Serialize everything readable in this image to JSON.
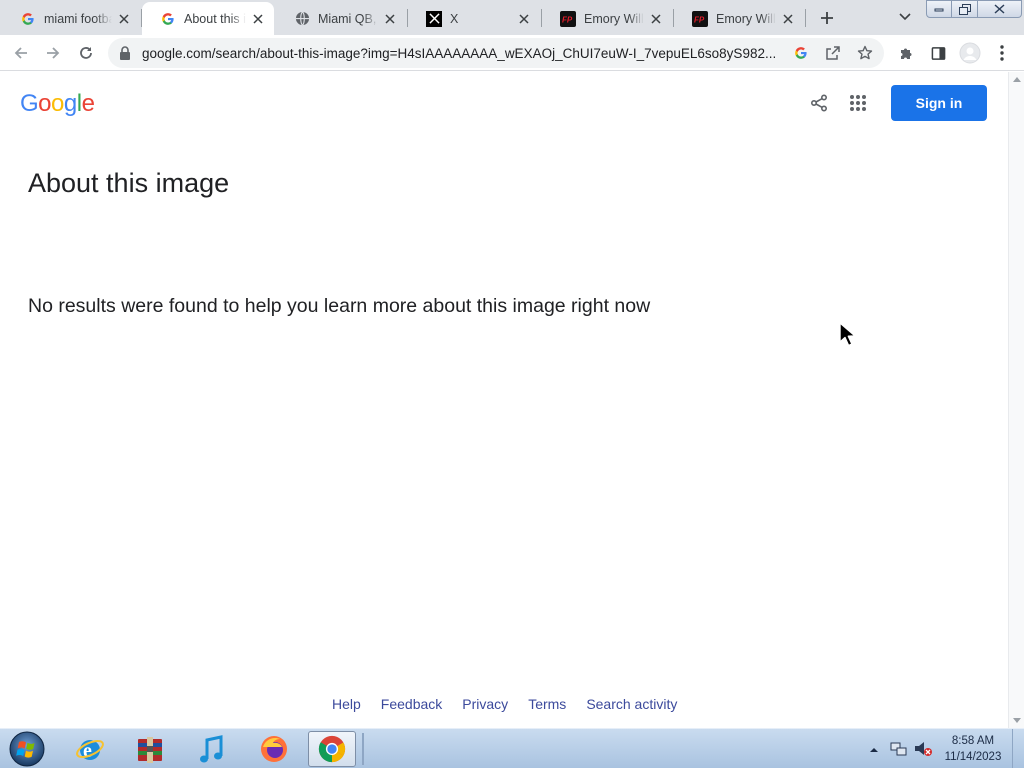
{
  "browser": {
    "tabs": [
      {
        "title": "miami football",
        "favicon": "google-g-icon",
        "active": false
      },
      {
        "title": "About this image",
        "favicon": "google-g-icon",
        "active": true
      },
      {
        "title": "Miami QB, Miami",
        "favicon": "globe-icon",
        "active": false
      },
      {
        "title": "X",
        "favicon": "x-logo-icon",
        "active": false
      },
      {
        "title": "Emory Williams",
        "favicon": "fp-logo-icon",
        "active": false
      },
      {
        "title": "Emory Williams",
        "favicon": "fp-logo-icon",
        "active": false
      }
    ],
    "url": "google.com/search/about-this-image?img=H4sIAAAAAAAA_wEXAOj_ChUI7euW-I_7vepuEL6so8yS982..."
  },
  "page": {
    "logo_text": "Google",
    "logo_colors": [
      "#4285F4",
      "#EA4335",
      "#FBBC05",
      "#4285F4",
      "#34A853",
      "#EA4335"
    ],
    "sign_in_label": "Sign in",
    "title": "About this image",
    "message": "No results were found to help you learn more about this image right now",
    "footer_links": [
      "Help",
      "Feedback",
      "Privacy",
      "Terms",
      "Search activity"
    ],
    "accent_color": "#1a73e8"
  },
  "taskbar": {
    "apps": [
      "internet-explorer-icon",
      "archive-icon",
      "itunes-icon",
      "firefox-icon",
      "chrome-icon"
    ],
    "time": "8:58 AM",
    "date": "11/14/2023"
  }
}
